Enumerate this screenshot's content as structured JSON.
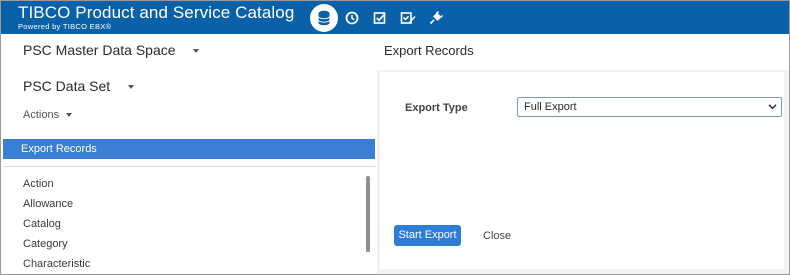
{
  "header": {
    "brand_title": "TIBCO Product and Service Catalog",
    "brand_subtitle": "Powered by TIBCO EBX®",
    "bg_color": "#0b61a8",
    "icons": [
      "database-icon",
      "clock-icon",
      "checkbox-icon",
      "edit-checkbox-icon",
      "plug-icon"
    ]
  },
  "sidebar": {
    "dataspace": "PSC Master Data Space",
    "dataset": "PSC Data Set",
    "actions_label": "Actions",
    "active_item": "Export Records",
    "items": [
      "Action",
      "Allowance",
      "Catalog",
      "Category",
      "Characteristic"
    ]
  },
  "main": {
    "title": "Export Records",
    "export_type_label": "Export Type",
    "export_type_value": "Full Export",
    "start_button": "Start Export",
    "close_button": "Close",
    "accent_color": "#2f7cd6"
  }
}
